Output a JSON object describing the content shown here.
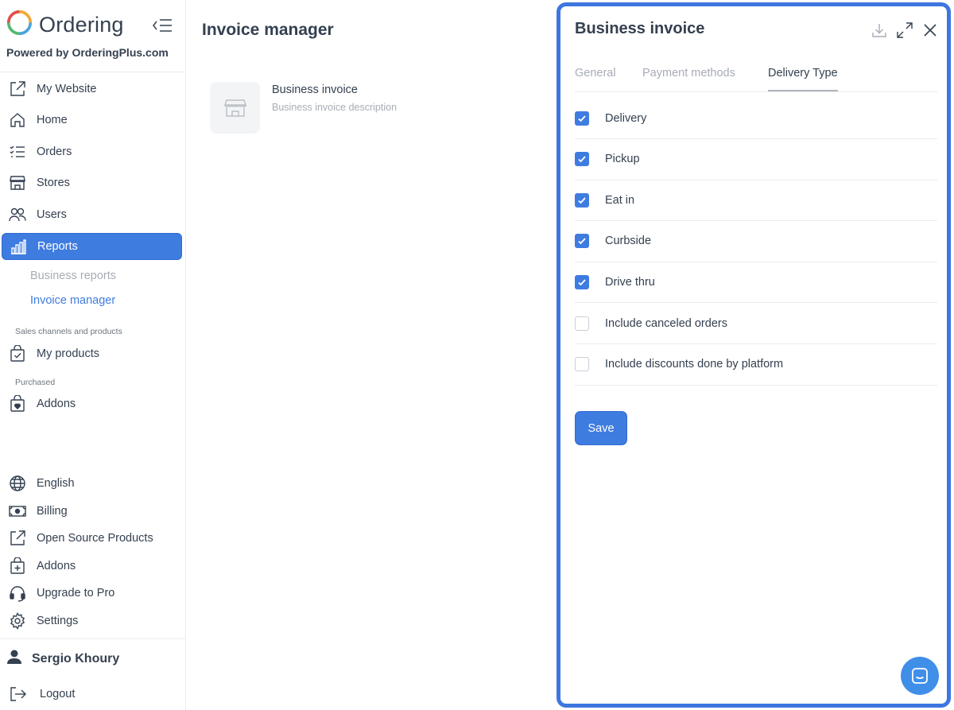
{
  "brand": {
    "name": "Ordering",
    "powered": "Powered by OrderingPlus.com"
  },
  "sidebar": {
    "items": [
      {
        "label": "My Website",
        "icon": "external-link-icon"
      },
      {
        "label": "Home",
        "icon": "home-icon"
      },
      {
        "label": "Orders",
        "icon": "list-icon"
      },
      {
        "label": "Stores",
        "icon": "shop-icon"
      },
      {
        "label": "Users",
        "icon": "users-icon"
      },
      {
        "label": "Reports",
        "icon": "bar-chart-icon",
        "active": true
      }
    ],
    "report_subitems": [
      {
        "label": "Business reports"
      },
      {
        "label": "Invoice manager",
        "current": true
      }
    ],
    "section_sales": "Sales channels and products",
    "my_products": "My products",
    "section_purchased": "Purchased",
    "addons_purchased": "Addons",
    "bottom_items": [
      {
        "label": "English",
        "icon": "globe-icon"
      },
      {
        "label": "Billing",
        "icon": "cash-icon"
      },
      {
        "label": "Open Source Products",
        "icon": "external-link-icon"
      },
      {
        "label": "Addons",
        "icon": "bag-plus-icon"
      },
      {
        "label": "Upgrade to Pro",
        "icon": "headset-icon"
      },
      {
        "label": "Settings",
        "icon": "gear-icon"
      }
    ],
    "user_name": "Sergio Khoury",
    "logout": "Logout"
  },
  "main": {
    "title": "Invoice manager",
    "card": {
      "title": "Business invoice",
      "description": "Business invoice description"
    }
  },
  "panel": {
    "title": "Business invoice",
    "tabs": [
      {
        "label": "General"
      },
      {
        "label": "Payment methods"
      },
      {
        "label": "Delivery Type",
        "active": true
      }
    ],
    "options": [
      {
        "label": "Delivery",
        "checked": true
      },
      {
        "label": "Pickup",
        "checked": true
      },
      {
        "label": "Eat in",
        "checked": true
      },
      {
        "label": "Curbside",
        "checked": true
      },
      {
        "label": "Drive thru",
        "checked": true
      },
      {
        "label": "Include canceled orders",
        "checked": false
      },
      {
        "label": "Include discounts done by platform",
        "checked": false
      }
    ],
    "save_label": "Save"
  },
  "colors": {
    "accent": "#3f7ce0",
    "panel_border": "#3e76e0",
    "text": "#344050",
    "muted": "#a7acb5"
  }
}
